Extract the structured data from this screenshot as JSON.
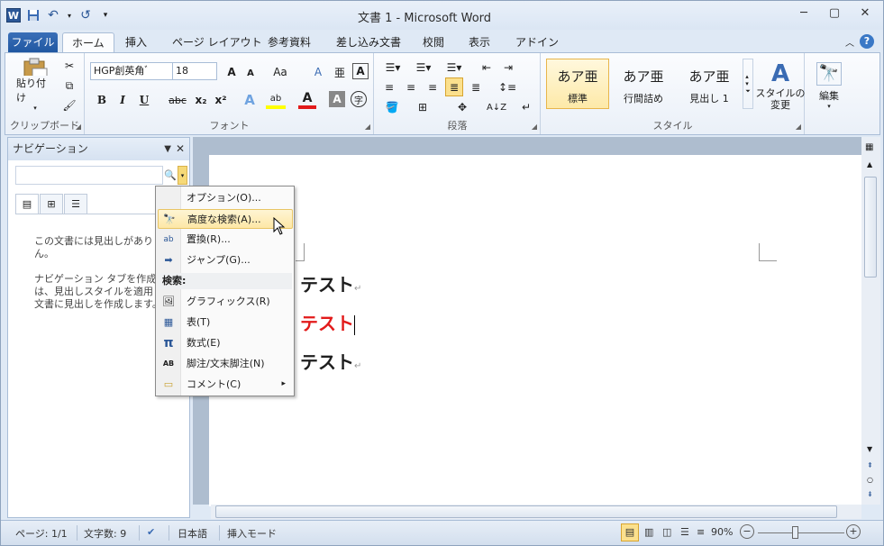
{
  "window": {
    "title": "文書 1 - Microsoft Word",
    "controls": [
      "─",
      "▢",
      "✕"
    ]
  },
  "qat": {
    "app_icon": "W",
    "save": "💾",
    "undo": "↶",
    "redo": "↺",
    "more": "▾"
  },
  "tabs": [
    "ファイル",
    "ホーム",
    "挿入",
    "ページ レイアウト",
    "参考資料",
    "差し込み文書",
    "校閲",
    "表示",
    "アドイン"
  ],
  "tab_help": "?",
  "ribbon": {
    "clipboard": {
      "label": "クリップボード",
      "paste": "貼り付け"
    },
    "font": {
      "label": "フォント",
      "name": "HGP創英角ﾞ",
      "size": "18",
      "bold": "B",
      "italic": "I",
      "underline": "U",
      "strike": "abc",
      "sub": "x₂",
      "sup": "x²",
      "grow": "A",
      "shrink": "A",
      "case": "Aa",
      "clear": "A",
      "ruby": "亜"
    },
    "paragraph": {
      "label": "段落"
    },
    "styles": {
      "label": "スタイル",
      "items": [
        {
          "preview": "あア亜",
          "name": "標準"
        },
        {
          "preview": "あア亜",
          "name": "行間詰め"
        },
        {
          "preview": "あア亜",
          "name": "見出し 1"
        }
      ],
      "change": "スタイルの\n変更"
    },
    "edit": {
      "label": "編集"
    }
  },
  "nav": {
    "title": "ナビゲーション",
    "search_placeholder": "",
    "body_lines": [
      "この文書には見出しがありませ",
      "ん。",
      "ナビゲーション タブを作成する",
      "は、見出しスタイルを適用して",
      "文書に見出しを作成します。"
    ]
  },
  "menu": {
    "items": [
      {
        "label": "オプション(O)...",
        "icon": ""
      },
      {
        "label": "高度な検索(A)...",
        "icon": "🔭"
      },
      {
        "label": "置換(R)...",
        "icon": "ab"
      },
      {
        "label": "ジャンプ(G)...",
        "icon": "➡"
      }
    ],
    "section": "検索:",
    "search_items": [
      {
        "label": "グラフィックス(R)",
        "icon": "🖼"
      },
      {
        "label": "表(T)",
        "icon": "▦"
      },
      {
        "label": "数式(E)",
        "icon": "π"
      },
      {
        "label": "脚注/文末脚注(N)",
        "icon": "AB"
      },
      {
        "label": "コメント(C)",
        "icon": "▭",
        "submenu": "▸"
      }
    ]
  },
  "document": {
    "lines": [
      {
        "text": "テスト",
        "color": "#000000"
      },
      {
        "text": "テスト",
        "color": "#e21a1a"
      },
      {
        "text": "テスト",
        "color": "#000000"
      }
    ],
    "para_mark": "↵"
  },
  "status": {
    "page": "ページ: 1/1",
    "words": "文字数: 9",
    "lang": "日本語",
    "mode": "挿入モード",
    "zoom": "90%",
    "minus": "−",
    "plus": "+"
  }
}
